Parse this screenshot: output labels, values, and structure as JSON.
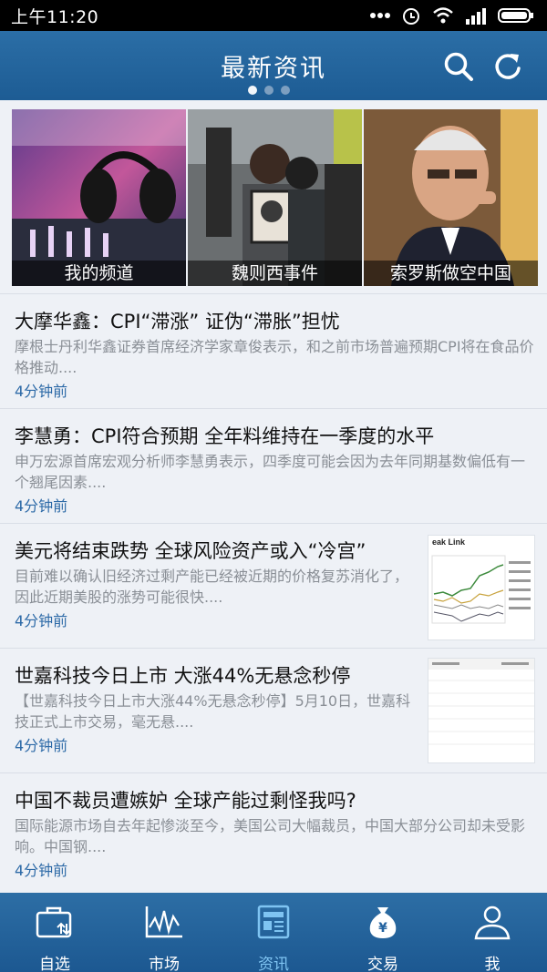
{
  "status_bar": {
    "time": "上午11:20"
  },
  "header": {
    "title": "最新资讯",
    "page_index": 0,
    "page_count": 3
  },
  "carousel": [
    {
      "caption": "我的频道"
    },
    {
      "caption": "魏则西事件"
    },
    {
      "caption": "索罗斯做空中国"
    }
  ],
  "news": [
    {
      "title": "大摩华鑫：CPI“滞涨” 证伪“滞胀”担忧",
      "desc": "摩根士丹利华鑫证券首席经济学家章俊表示，和之前市场普遍预期CPI将在食品价格推动....",
      "time": "4分钟前"
    },
    {
      "title": "李慧勇：CPI符合预期 全年料维持在一季度的水平",
      "desc": "申万宏源首席宏观分析师李慧勇表示，四季度可能会因为去年同期基数偏低有一个翘尾因素....",
      "time": "4分钟前"
    },
    {
      "title": "美元将结束跌势 全球风险资产或入“冷宫”",
      "desc": "目前难以确认旧经济过剩产能已经被近期的价格复苏消化了，因此近期美股的涨势可能很快....",
      "time": "4分钟前",
      "thumb_text": "eak Link"
    },
    {
      "title": "世嘉科技今日上市 大涨44%无悬念秒停",
      "desc": "【世嘉科技今日上市大涨44%无悬念秒停】5月10日，世嘉科技正式上市交易，毫无悬....",
      "time": "4分钟前"
    },
    {
      "title": "中国不裁员遭嫉妒 全球产能过剩怪我吗?",
      "desc": "国际能源市场自去年起惨淡至今，美国公司大幅裁员，中国大部分公司却未受影响。中国钢....",
      "time": "4分钟前"
    }
  ],
  "tabs": [
    {
      "label": "自选",
      "icon": "watchlist-icon"
    },
    {
      "label": "市场",
      "icon": "market-chart-icon"
    },
    {
      "label": "资讯",
      "icon": "news-icon",
      "active": true
    },
    {
      "label": "交易",
      "icon": "money-bag-icon"
    },
    {
      "label": "我",
      "icon": "user-icon"
    }
  ]
}
